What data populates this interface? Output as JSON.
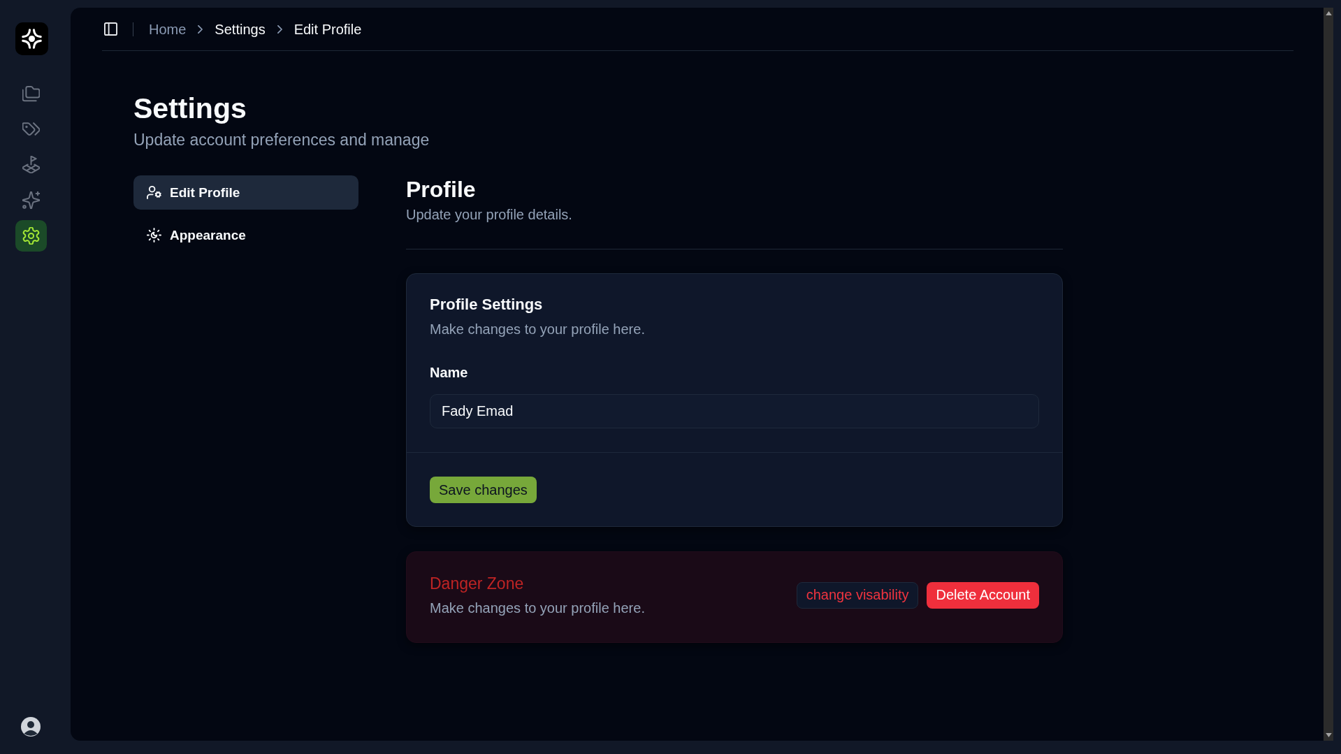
{
  "sidebar": {
    "nav_items": [
      {
        "selected": false
      },
      {
        "selected": false
      },
      {
        "selected": false
      },
      {
        "selected": false
      },
      {
        "selected": true
      }
    ]
  },
  "breadcrumb": [
    {
      "label": "Home",
      "dimmed": true
    },
    {
      "label": "Settings",
      "dimmed": false
    },
    {
      "label": "Edit Profile",
      "dimmed": false
    }
  ],
  "page": {
    "title": "Settings",
    "subtitle": "Update account preferences and manage"
  },
  "settings_nav": [
    {
      "label": "Edit Profile",
      "selected": true
    },
    {
      "label": "Appearance",
      "selected": false
    }
  ],
  "section": {
    "title": "Profile",
    "subtitle": "Update your profile details."
  },
  "profile_card": {
    "title": "Profile Settings",
    "description": "Make changes to your profile here.",
    "name_field": {
      "label": "Name",
      "value": "Fady Emad"
    },
    "save_button": "Save changes"
  },
  "danger_zone": {
    "title": "Danger Zone",
    "description": "Make changes to your profile here.",
    "buttons": [
      {
        "label": "change visability",
        "kind": "outline"
      },
      {
        "label": "Delete Account",
        "kind": "destructive"
      }
    ]
  }
}
